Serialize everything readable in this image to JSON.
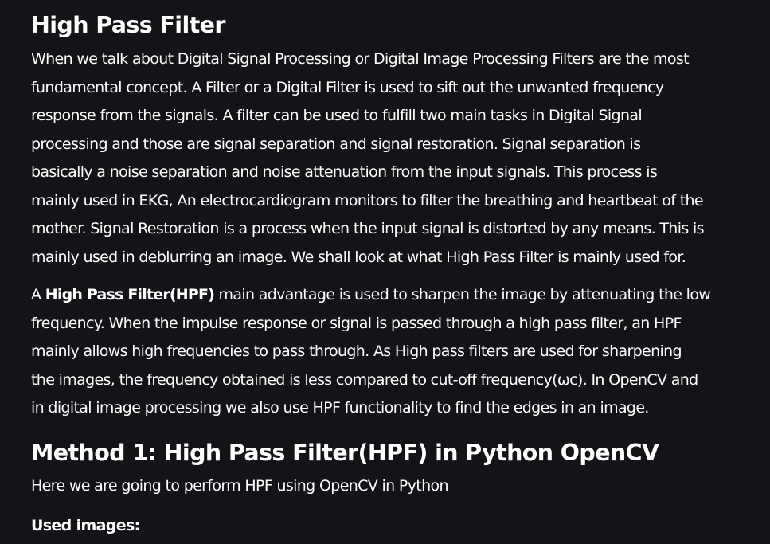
{
  "article": {
    "title": "High Pass Filter",
    "intro_lines": [
      "When we talk about Digital Signal Processing or Digital Image Processing Filters are the most",
      "fundamental concept. A Filter or a Digital Filter is used to sift out the unwanted frequency",
      "response from the signals. A filter can be used to fulfill two main tasks in Digital Signal",
      "processing and those are signal separation and signal restoration. Signal separation is",
      "basically a noise separation and noise attenuation from the input signals. This process is",
      "mainly used in EKG, An electrocardiogram monitors to filter the breathing and heartbeat of the",
      "mother. Signal Restoration is a process when the input signal is distorted by any means. This is",
      "mainly used in deblurring an image. We shall look at what High Pass Filter is mainly used for."
    ],
    "hpf_paragraph": {
      "first_line_prefix": "A ",
      "first_line_bold": "High Pass Filter(HPF)",
      "first_line_rest": " main advantage is used to sharpen the image by attenuating the low",
      "lines": [
        "frequency. When the impulse response or signal is passed through a high pass filter, an HPF",
        "mainly allows high frequencies to pass through. As High pass filters are used for sharpening",
        "the images, the frequency obtained is less compared to cut-off frequency(ωc). In OpenCV and",
        "in digital image processing we also use HPF functionality to find the edges in an image."
      ]
    },
    "method_heading": "Method 1: High Pass Filter(HPF) in Python OpenCV",
    "method_intro": "Here we are going to perform HPF using OpenCV in Python",
    "used_images_label": "Used images:"
  }
}
